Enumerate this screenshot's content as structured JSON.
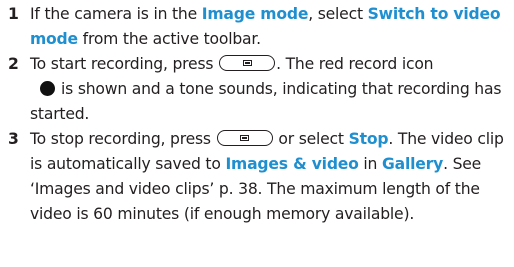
{
  "steps": [
    {
      "number": "1",
      "t1": "If the camera is in the ",
      "l1": "Image mode",
      "t2": ", select ",
      "l2": "Switch to video mode",
      "t3": " from the active toolbar."
    },
    {
      "number": "2",
      "t1": "To start recording, press ",
      "t2": ". The red record icon",
      "t3": "is shown and a tone sounds, indicating that recording has started."
    },
    {
      "number": "3",
      "t1": "To stop recording, press ",
      "t2": " or select ",
      "l1": "Stop",
      "t3": ". The video clip is automatically saved to ",
      "l2": "Images & video",
      "t4": " in ",
      "l3": "Gallery",
      "t5": ". See ‘Images and video clips’ p. 38. The maximum length of the video is 60 minutes (if enough memory available)."
    }
  ],
  "icons": {
    "capture_key": "camera-capture-key-icon",
    "record_dot": "record-icon"
  },
  "colors": {
    "highlight": "#1f8fd0",
    "text": "#231f20"
  }
}
